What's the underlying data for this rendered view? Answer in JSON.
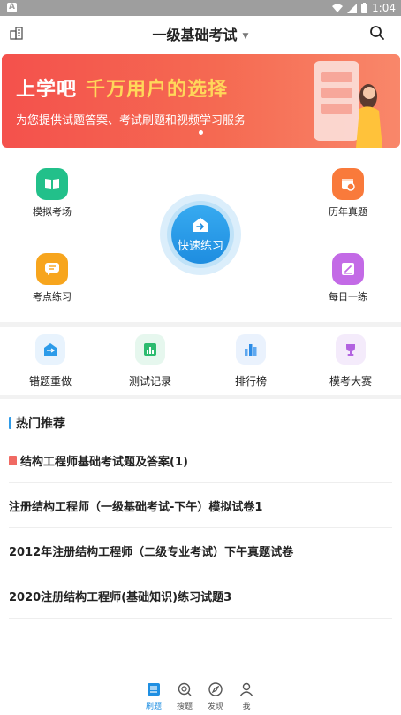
{
  "status_bar": {
    "time": "1:04"
  },
  "header": {
    "title": "一级基础考试"
  },
  "banner": {
    "headline_part1": "上学吧",
    "headline_part2": "千万用户的选择",
    "subtitle": "为您提供试题答案、考试刷题和视频学习服务"
  },
  "practice": {
    "mock_exam": "模拟考场",
    "past_papers": "历年真题",
    "quick_practice": "快速练习",
    "topic_practice": "考点练习",
    "daily_practice": "每日一练"
  },
  "tools": [
    {
      "label": "错题重做"
    },
    {
      "label": "测试记录"
    },
    {
      "label": "排行榜"
    },
    {
      "label": "模考大赛"
    }
  ],
  "hot": {
    "heading": "热门推荐",
    "items": [
      {
        "title": "结构工程师基础考试题及答案(1)"
      },
      {
        "title": "注册结构工程师（一级基础考试-下午）模拟试卷1"
      },
      {
        "title": "2012年注册结构工程师（二级专业考试）下午真题试卷"
      },
      {
        "title": "2020注册结构工程师(基础知识)练习试题3"
      }
    ]
  },
  "tabbar": [
    {
      "label": "刷题",
      "icon": "list-icon",
      "active": true
    },
    {
      "label": "搜题",
      "icon": "search-question-icon",
      "active": false
    },
    {
      "label": "发现",
      "icon": "compass-icon",
      "active": false
    },
    {
      "label": "我",
      "icon": "person-icon",
      "active": false
    }
  ],
  "colors": {
    "accent": "#1f8fe2",
    "banner_start": "#f4514c",
    "banner_highlight": "#ffd75a",
    "mock_exam": "#22c08a",
    "past_papers": "#f97a3b",
    "topic_practice": "#f7a51d",
    "daily_practice": "#c36ae6"
  }
}
